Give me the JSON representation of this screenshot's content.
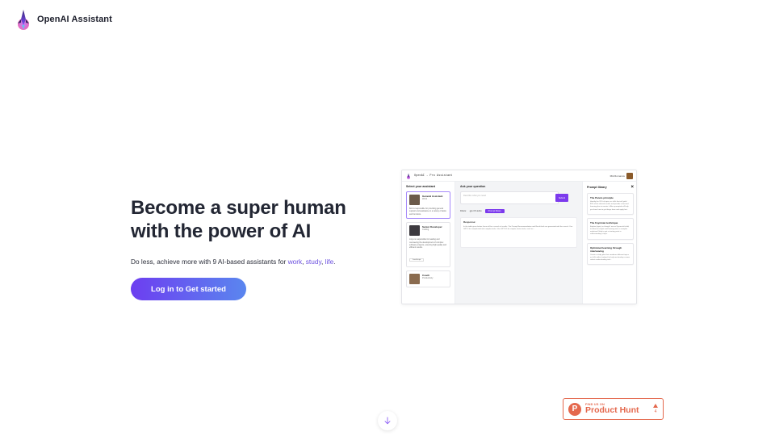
{
  "header": {
    "brand": "OpenAI Assistant"
  },
  "hero": {
    "title_line1": "Become a super human",
    "title_line2": "with the power of AI",
    "subtitle_prefix": "Do less, achieve more with 9 AI-based assistants for ",
    "link_work": "work",
    "sep1": ", ",
    "link_study": "study",
    "sep2": ", ",
    "link_life": "life",
    "subtitle_suffix": ".",
    "cta_label": "Log in to Get started"
  },
  "preview": {
    "app_title": "OpenAI - Pro Assistant",
    "account": "Mik Romanov",
    "select_heading": "Select your assistant",
    "assistants": [
      {
        "name": "General Assistant",
        "tag": "Work",
        "desc": "Bob is responsible for providing general support and assistance in a variety of tasks and functions."
      },
      {
        "name": "Senior Developer",
        "tag": "Coding",
        "desc": "Linyu is responsible for leading and overseeing the development of complex software projects, ensuring high quality and efficient results.",
        "chip": "JavaScript"
      },
      {
        "name": "Coach",
        "tag": "Productivity",
        "desc": ""
      }
    ],
    "ask_heading": "Ask your question",
    "question_placeholder": "Describe what you need",
    "submit_label": "Submit",
    "filters_label": "Filters:",
    "filter_option": "gpt-3.5-turbo",
    "filter_chip": "Prompt library",
    "response_heading": "Response:",
    "response_text": "In the table given below, there will be a search of results. The Prompt Recommendation and Result both are generated with the search. Use GPT-4 for complicated and complex tasks. Use GPT-3.5 for simpler, faster tasks, such as...",
    "library_heading": "Prompt library",
    "prompts": [
      {
        "title": "The Pareto principle",
        "text": "Identify the 20% of topics or skills that will yield 80% of the desired results and provide a focused learning plan to master it. Also prompted will help you learn how to get things done and apply fast."
      },
      {
        "title": "The Feynman technique",
        "text": "Explain (topic) as though I am an 8-year-old child, to allow for simple and learning once a complex explained. Help to get a starting point in understanding a topic."
      },
      {
        "title": "Optimized learning through interleaving",
        "text": "Create a study plan that combines different topics or skills within (subject) to help me develop a more robust understanding and..."
      }
    ]
  },
  "product_hunt": {
    "small": "FIND US ON",
    "big": "Product Hunt",
    "votes": "4"
  }
}
